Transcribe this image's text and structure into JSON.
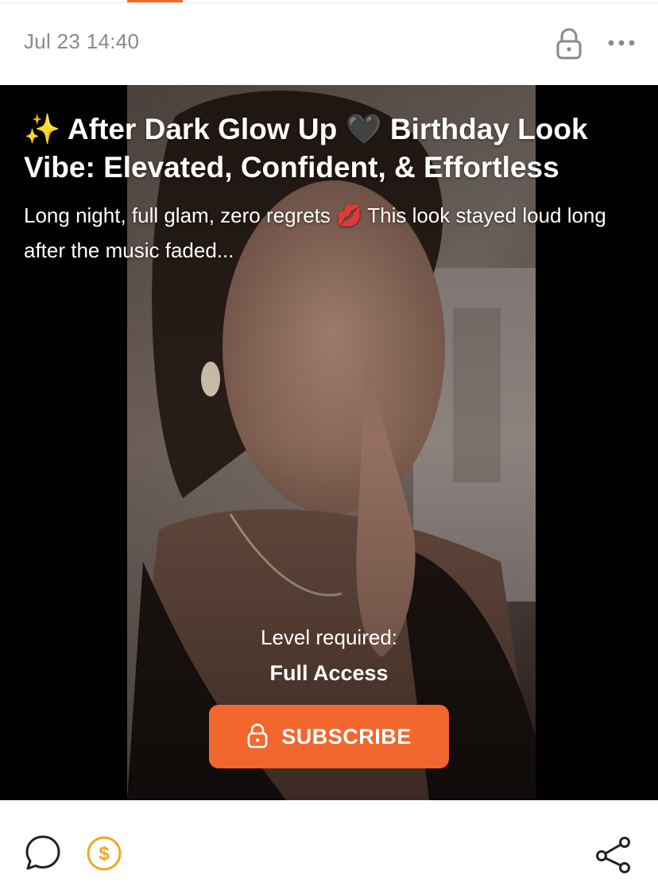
{
  "header": {
    "date": "Jul 23 14:40",
    "lock_icon": "lock-icon",
    "more_icon": "more-horizontal-icon"
  },
  "post": {
    "title": "✨ After Dark Glow Up 🖤 Birthday Look Vibe: Elevated, Confident, & Effortless",
    "description": "Long night, full glam, zero regrets 💋 This look stayed loud long after the music faded...",
    "level_label": "Level required:",
    "level_value": "Full Access",
    "subscribe_label": "SUBSCRIBE"
  },
  "footer": {
    "comment_icon": "comment-icon",
    "tip_icon": "tip-dollar-icon",
    "share_icon": "share-icon"
  },
  "colors": {
    "accent": "#f26a2e",
    "date_text": "#8a8a8a",
    "tip_icon": "#f5a623",
    "media_background": "#000000"
  }
}
